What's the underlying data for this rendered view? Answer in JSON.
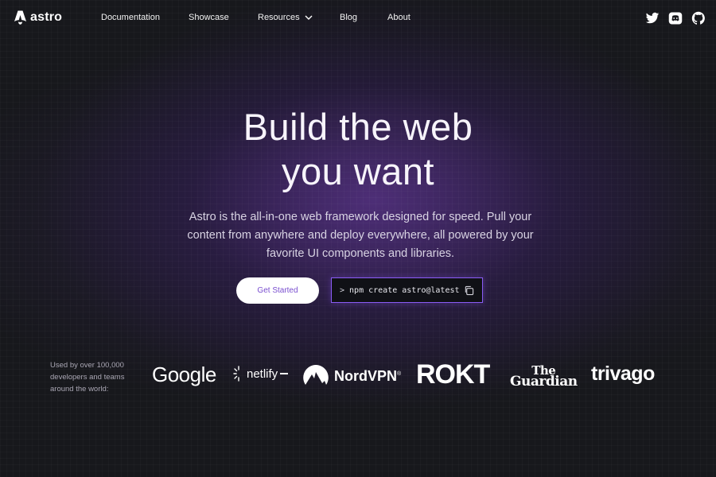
{
  "nav": {
    "brand": "astro",
    "links": [
      "Documentation",
      "Showcase",
      "Resources",
      "Blog",
      "About"
    ],
    "social_icons": [
      "twitter-icon",
      "discord-icon",
      "github-icon"
    ]
  },
  "hero": {
    "title_line1": "Build the web",
    "title_line2": "you want",
    "subtitle": "Astro is the all-in-one web framework designed for speed. Pull your content from anywhere and deploy everywhere, all powered by your favorite UI components and libraries.",
    "cta_label": "Get Started",
    "command_prompt": ">",
    "command": "npm create astro@latest"
  },
  "customers": {
    "caption": "Used by over 100,000 developers and teams around the world:",
    "logos": [
      "Google",
      "netlify",
      "NordVPN",
      "ROKT",
      "The Guardian",
      "trivago"
    ],
    "netlify": "netlify",
    "nordvpn": "NordVPN",
    "nordvpn_mark": "®",
    "guardian_line1": "The",
    "guardian_line2": "Guardian"
  },
  "colors": {
    "background": "#17181c",
    "accent": "#8a5cf5",
    "cta_text": "#7a4fcf"
  }
}
